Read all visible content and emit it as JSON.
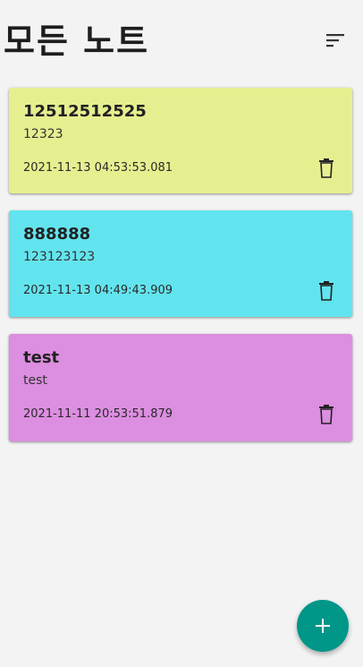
{
  "header": {
    "title": "모든 노트",
    "sort_icon": "sort-icon"
  },
  "notes": [
    {
      "title": "12512512525",
      "content": "12323",
      "date": "2021-11-13 04:53:53.081",
      "color": "#e6ef8f",
      "icon": "trash-icon"
    },
    {
      "title": "888888",
      "content": "123123123",
      "date": "2021-11-13 04:49:43.909",
      "color": "#62e4ee",
      "icon": "trash-icon"
    },
    {
      "title": "test",
      "content": "test",
      "date": "2021-11-11 20:53:51.879",
      "color": "#dc8ee0",
      "icon": "trash-icon"
    }
  ],
  "fab": {
    "icon": "plus-icon",
    "color": "#009688"
  }
}
